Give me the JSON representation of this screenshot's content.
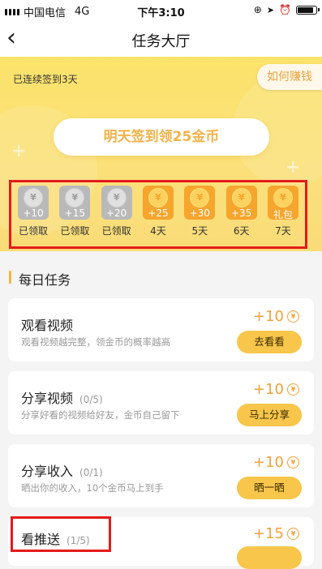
{
  "status_bar": {
    "carrier": "中国电信",
    "network": "4G",
    "time": "下午3:10",
    "battery_level": 0.85
  },
  "nav": {
    "title": "任务大厅"
  },
  "banner": {
    "checkin_text": "已连续签到3天",
    "earn_button": "如何赚钱",
    "tomorrow_button": "明天签到领25金币",
    "days": [
      {
        "amount": "+10",
        "label": "已领取",
        "state": "done"
      },
      {
        "amount": "+15",
        "label": "已领取",
        "state": "done"
      },
      {
        "amount": "+20",
        "label": "已领取",
        "state": "done"
      },
      {
        "amount": "+25",
        "label": "4天",
        "state": "todo"
      },
      {
        "amount": "+30",
        "label": "5天",
        "state": "todo"
      },
      {
        "amount": "+35",
        "label": "6天",
        "state": "todo"
      },
      {
        "amount": "礼包",
        "label": "7天",
        "state": "todo"
      }
    ]
  },
  "section_title": "每日任务",
  "tasks": [
    {
      "name": "观看视频",
      "progress": "",
      "desc": "观看视频越完整，领金币的概率越高",
      "reward": "+10",
      "button": "去看看"
    },
    {
      "name": "分享视频",
      "progress": "(0/5)",
      "desc": "分享好看的视频给好友，金币自己留下",
      "reward": "+10",
      "button": "马上分享"
    },
    {
      "name": "分享收入",
      "progress": "(0/1)",
      "desc": "晒出你的收入，10个金币马上到手",
      "reward": "+10",
      "button": "晒一晒"
    },
    {
      "name": "看推送",
      "progress": "(1/5)",
      "desc": "",
      "reward": "+15",
      "button": ""
    }
  ],
  "coin_symbol": "¥",
  "colors": {
    "accent": "#f0a23c",
    "button": "#f7c64a",
    "highlight": "#e41b1b"
  }
}
